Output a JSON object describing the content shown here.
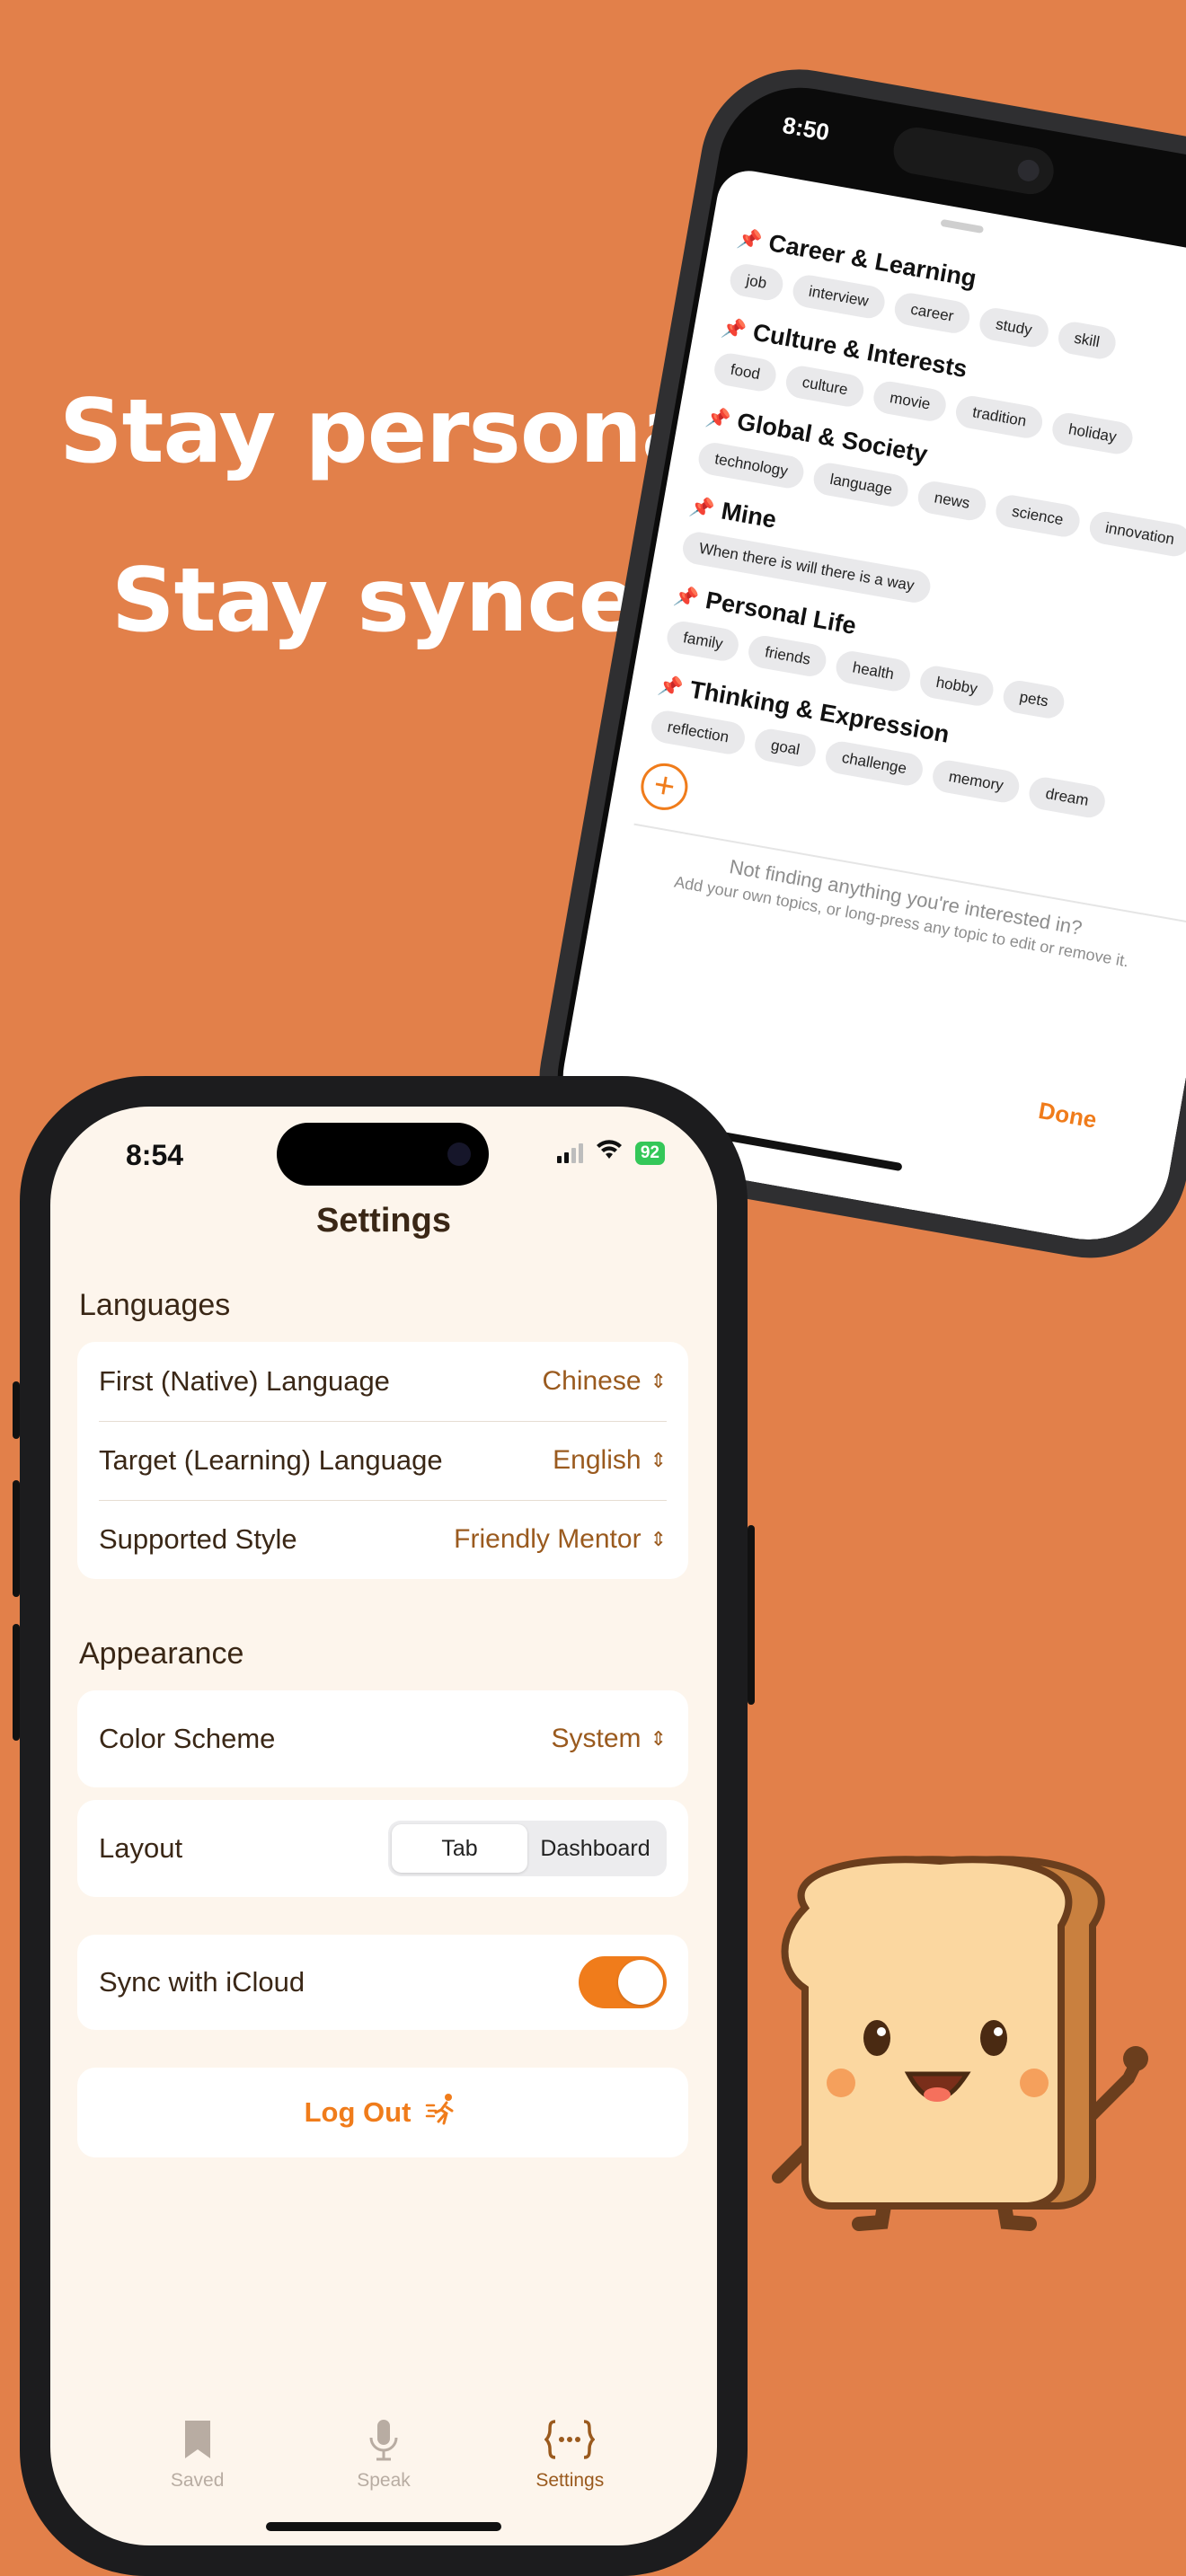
{
  "promo": {
    "line1": "Stay personal",
    "line2": "Stay synced"
  },
  "back_phone": {
    "time": "8:50",
    "topics": [
      {
        "title": "Career & Learning",
        "tags": [
          "job",
          "interview",
          "career",
          "study",
          "skill"
        ]
      },
      {
        "title": "Culture & Interests",
        "tags": [
          "food",
          "culture",
          "movie",
          "tradition",
          "holiday"
        ]
      },
      {
        "title": "Global & Society",
        "tags": [
          "technology",
          "language",
          "news",
          "science",
          "innovation"
        ]
      },
      {
        "title": "Mine",
        "tags": [
          "When there is will there is a way"
        ]
      },
      {
        "title": "Personal Life",
        "tags": [
          "family",
          "friends",
          "health",
          "hobby",
          "pets"
        ]
      },
      {
        "title": "Thinking & Expression",
        "tags": [
          "reflection",
          "goal",
          "challenge",
          "memory",
          "dream"
        ]
      }
    ],
    "not_finding": "Not finding anything you're interested in?",
    "hint": "Add your own topics, or long-press any topic to edit or remove it.",
    "done_label": "Done"
  },
  "status": {
    "time": "8:54",
    "battery": "92"
  },
  "settings": {
    "title": "Settings",
    "languages_header": "Languages",
    "first_language": {
      "label": "First (Native) Language",
      "value": "Chinese"
    },
    "target_language": {
      "label": "Target (Learning) Language",
      "value": "English"
    },
    "supported_style": {
      "label": "Supported Style",
      "value": "Friendly Mentor"
    },
    "appearance_header": "Appearance",
    "color_scheme": {
      "label": "Color Scheme",
      "value": "System"
    },
    "layout": {
      "label": "Layout",
      "options": [
        "Tab",
        "Dashboard"
      ],
      "selected": "Tab"
    },
    "sync": {
      "label": "Sync with iCloud",
      "enabled": true
    },
    "logout_label": "Log Out"
  },
  "tabbar": {
    "saved": "Saved",
    "speak": "Speak",
    "settings": "Settings"
  },
  "colors": {
    "background": "#E2804A",
    "accent": "#F07C1B",
    "brown": "#9A5A1E",
    "screen_bg": "#FDF5EC"
  }
}
